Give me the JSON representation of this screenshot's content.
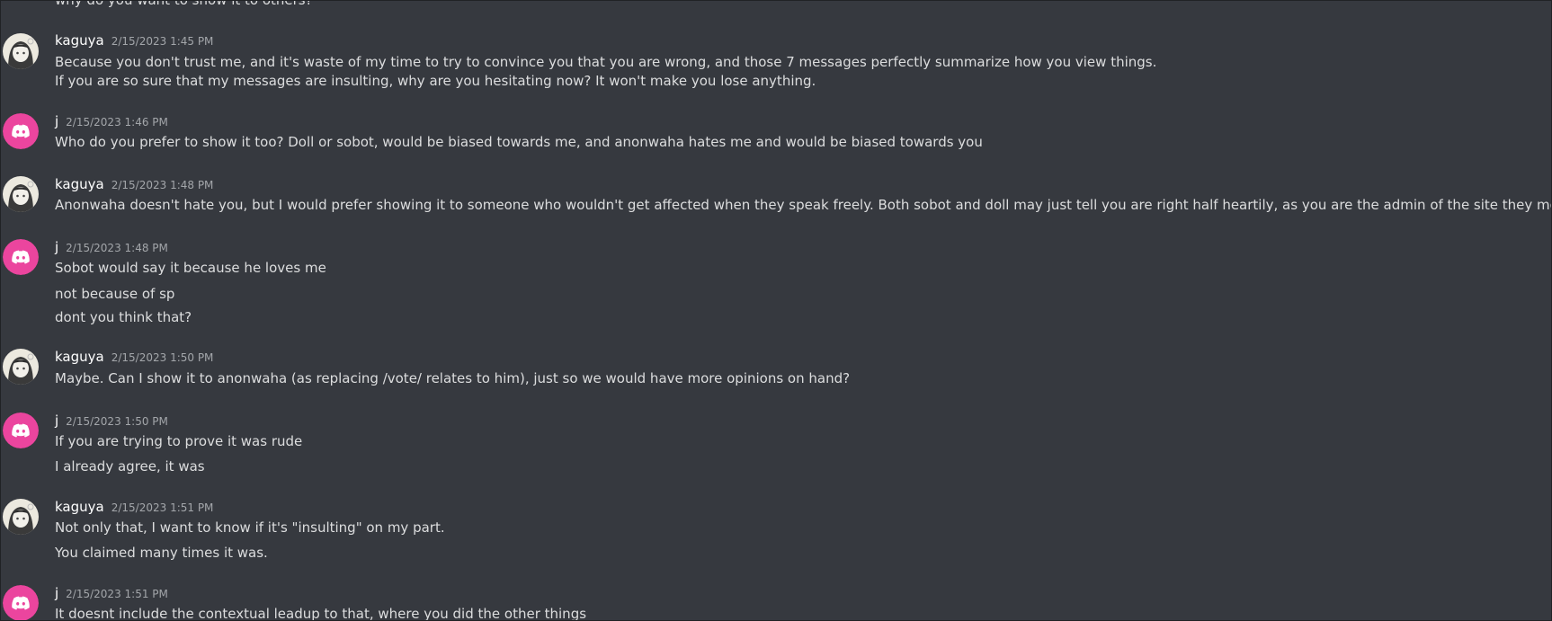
{
  "channel_messages": {
    "top_partial": "why do you want to show it to others?",
    "groups": [
      {
        "author": "kaguya",
        "avatar_icon": "anime-girl-avatar-icon",
        "timestamp": "2/15/2023 1:45 PM",
        "lines": [
          "Because you don't trust me, and it's waste of my time to try to convince you that you are wrong, and those 7 messages perfectly summarize how you view things.",
          "If you are so sure that my messages are insulting, why are you hesitating now? It won't make you lose anything."
        ]
      },
      {
        "author": "j",
        "avatar_icon": "discord-logo-avatar-icon",
        "timestamp": "2/15/2023 1:46 PM",
        "lines": [
          "Who do you prefer to show it too? Doll or sobot, would be biased towards me, and anonwaha hates me and would be biased towards you"
        ]
      },
      {
        "author": "kaguya",
        "avatar_icon": "anime-girl-avatar-icon",
        "timestamp": "2/15/2023 1:48 PM",
        "lines": [
          "Anonwaha doesn't hate you, but I would prefer showing it to someone who wouldn't get affected when they speak freely. Both sobot and doll may just tell you are right half heartily, as you are the admin of the site they moderate"
        ]
      },
      {
        "author": "j",
        "avatar_icon": "discord-logo-avatar-icon",
        "timestamp": "2/15/2023 1:48 PM",
        "lines": [
          "Sobot would say it because he loves me",
          "not because of sp",
          "dont you think that?"
        ]
      },
      {
        "author": "kaguya",
        "avatar_icon": "anime-girl-avatar-icon",
        "timestamp": "2/15/2023 1:50 PM",
        "lines": [
          "Maybe. Can I show it to anonwaha (as replacing /vote/ relates to him), just so we would have more opinions on hand?"
        ]
      },
      {
        "author": "j",
        "avatar_icon": "discord-logo-avatar-icon",
        "timestamp": "2/15/2023 1:50 PM",
        "lines": [
          "If you are trying to prove it was rude",
          "I already agree, it was"
        ]
      },
      {
        "author": "kaguya",
        "avatar_icon": "anime-girl-avatar-icon",
        "timestamp": "2/15/2023 1:51 PM",
        "lines": [
          "Not only that, I want to know if it's \"insulting\" on my part.",
          "You claimed many times it was."
        ]
      },
      {
        "author": "j",
        "avatar_icon": "discord-logo-avatar-icon",
        "timestamp": "2/15/2023 1:51 PM",
        "lines": [
          "It doesnt include the contextual leadup to that, where you did the other things"
        ]
      }
    ]
  },
  "colors": {
    "background": "#36393f",
    "text": "#dcddde",
    "username": "#ffffff",
    "timestamp": "#a3a6aa",
    "discord_avatar_bg": "#eb459e"
  }
}
